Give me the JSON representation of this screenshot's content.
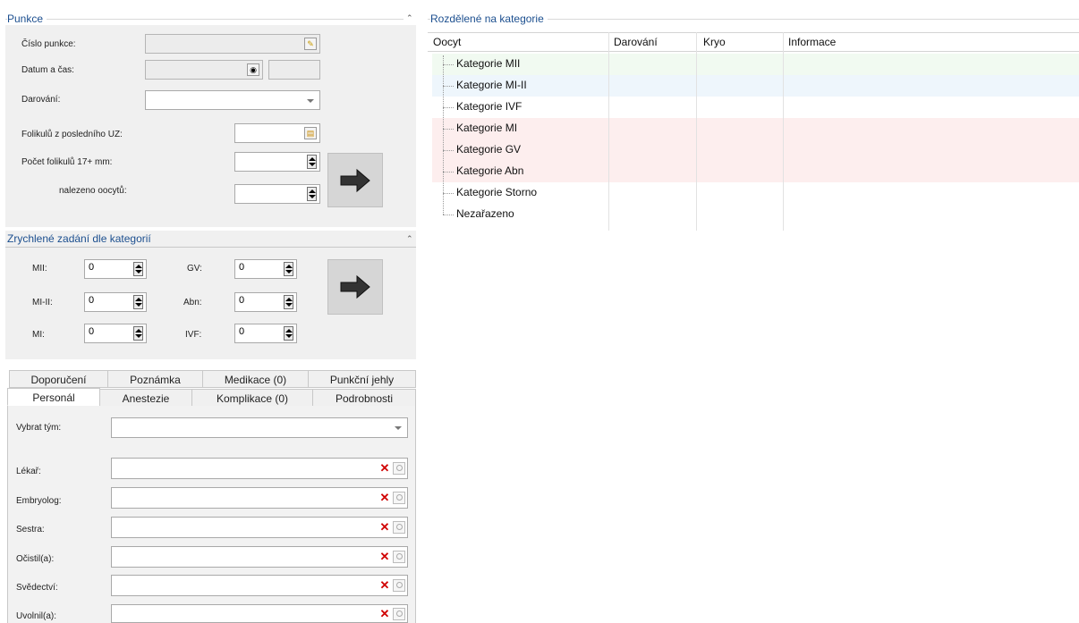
{
  "punkce": {
    "title": "Punkce",
    "cislo_label": "Číslo punkce:",
    "datum_label": "Datum a čas:",
    "darovani_label": "Darování:",
    "foliku_uz_label": "Folikulů z posledního UZ:",
    "pocet_label": "Počet folikulů 17+ mm:",
    "nalezeno_label": "nalezeno oocytů:"
  },
  "quick": {
    "title": "Zrychlené zadání dle kategorií",
    "fields": [
      {
        "label": "MII:",
        "value": "0"
      },
      {
        "label": "GV:",
        "value": "0"
      },
      {
        "label": "MI-II:",
        "value": "0"
      },
      {
        "label": "Abn:",
        "value": "0"
      },
      {
        "label": "MI:",
        "value": "0"
      },
      {
        "label": "IVF:",
        "value": "0"
      }
    ]
  },
  "tabs": {
    "row1": [
      "Doporučení",
      "Poznámka",
      "Medikace (0)",
      "Punkční jehly"
    ],
    "row2": [
      "Personál",
      "Anestezie",
      "Komplikace (0)",
      "Podrobnosti"
    ],
    "active": "Personál"
  },
  "personal": {
    "vybrat_label": "Vybrat tým:",
    "rows": [
      "Lékař:",
      "Embryolog:",
      "Sestra:",
      "Očistil(a):",
      "Svědectví:",
      "Uvolnil(a):"
    ]
  },
  "categories": {
    "title": "Rozdělené na kategorie",
    "columns": [
      "Oocyt",
      "Darování",
      "Kryo",
      "Informace"
    ],
    "rows": [
      {
        "label": "Kategorie MII",
        "color": "#f1faf1"
      },
      {
        "label": "Kategorie MI-II",
        "color": "#eef6fc"
      },
      {
        "label": "Kategorie IVF",
        "color": "#ffffff"
      },
      {
        "label": "Kategorie MI",
        "color": "#fdeeee"
      },
      {
        "label": "Kategorie GV",
        "color": "#fdeeee"
      },
      {
        "label": "Kategorie Abn",
        "color": "#fdeeee"
      },
      {
        "label": "Kategorie Storno",
        "color": "#ffffff"
      },
      {
        "label": "Nezařazeno",
        "color": "#ffffff"
      }
    ]
  },
  "colors": {
    "group_title": "#1c4f8f",
    "clear_icon": "#d00000"
  }
}
